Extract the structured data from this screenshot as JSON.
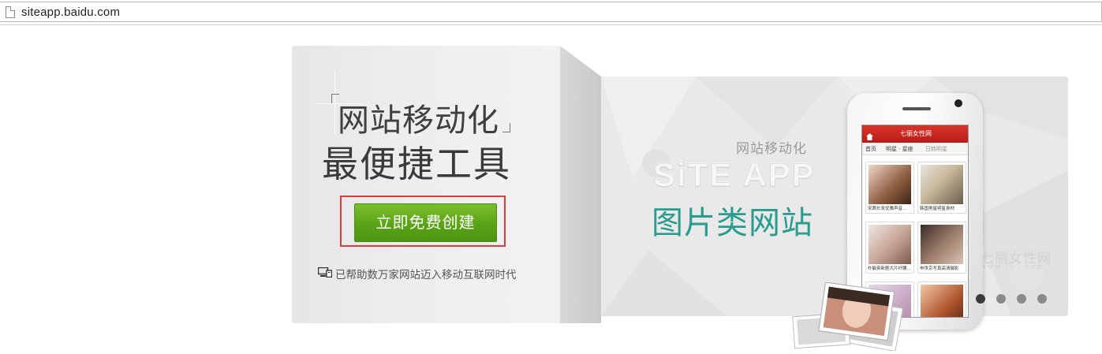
{
  "browser": {
    "url": "siteapp.baidu.com",
    "page_icon": "page-icon"
  },
  "hero": {
    "headline_line1": "网站移动化",
    "headline_line2": "最便捷工具",
    "cta_label": "立即免费创建",
    "note_icon": "devices-icon",
    "note_text": "已帮助数万家网站迈入移动互联网时代"
  },
  "banner": {
    "subtitle": "网站移动化",
    "title": "SiTE APP",
    "category": "图片类网站",
    "watermark": "七丽女性网",
    "watermark_url": "www.7y7.com",
    "accent_color": "#2a9c8e",
    "dots_count": 4,
    "active_dot": 1
  },
  "phone": {
    "app_title": "七丽女性网",
    "nav": [
      "首页",
      "明星 · 星座",
      "日韩明星"
    ],
    "tiles": [
      {
        "caption": "宋茜长发优雅声音..."
      },
      {
        "caption": "韩国男星明星身材"
      },
      {
        "caption": "朴敏英新剧大片纤腰..."
      },
      {
        "caption": "申世京写真高清摄影"
      }
    ]
  },
  "colors": {
    "cta_green": "#5aa317",
    "highlight_red": "#e23a3a",
    "app_red": "#c4241d"
  }
}
